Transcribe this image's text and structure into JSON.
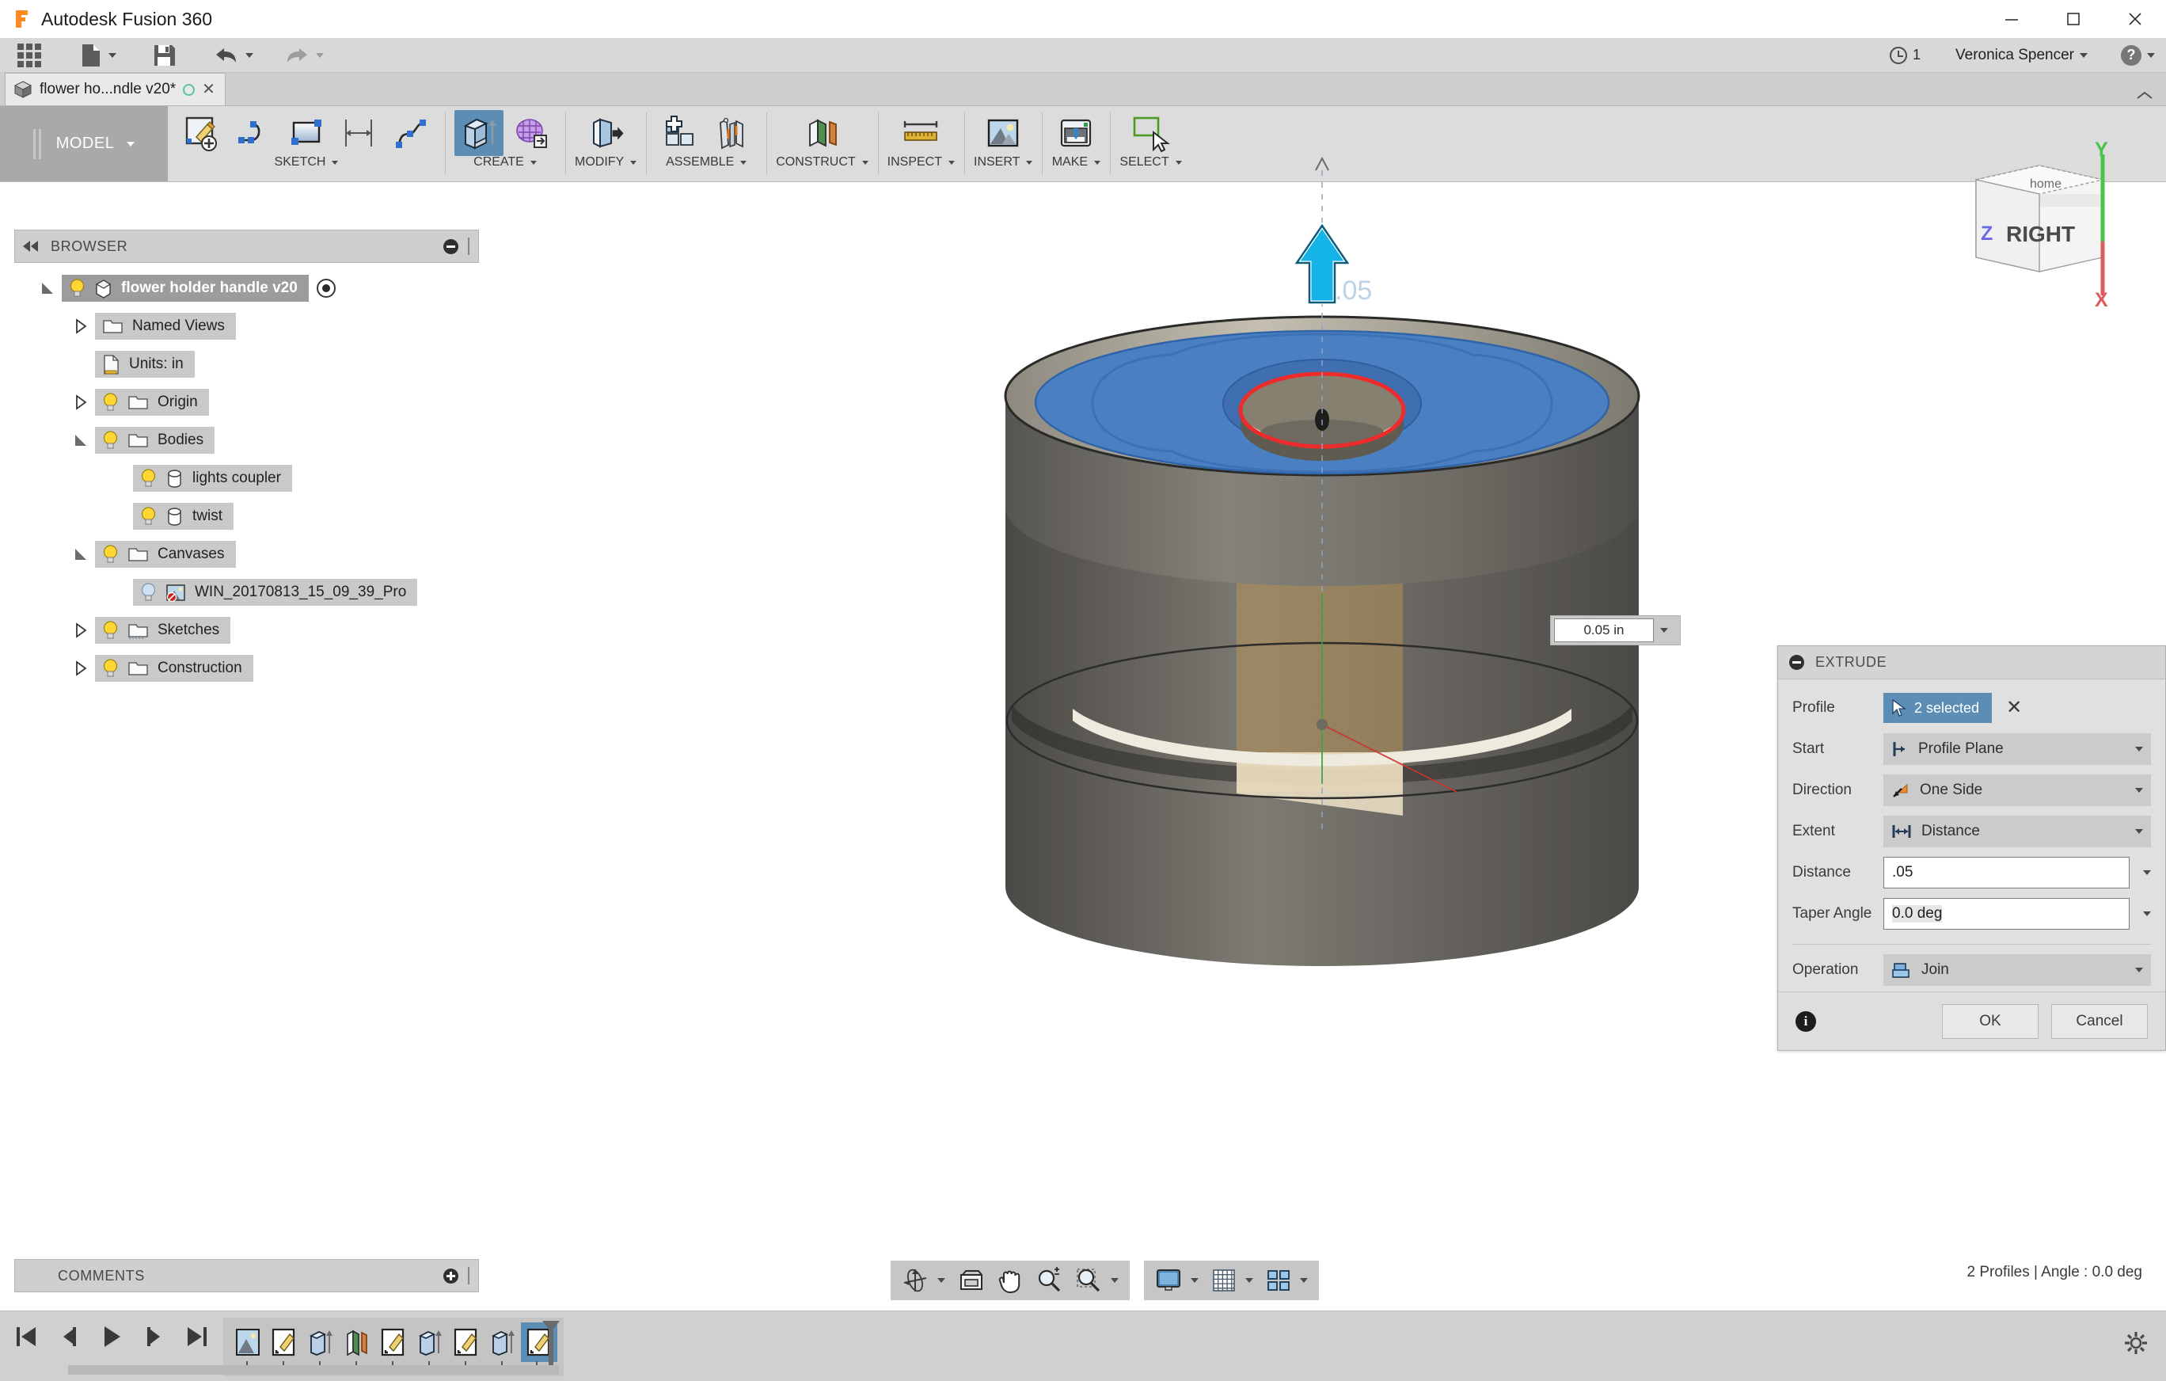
{
  "window": {
    "title": "Autodesk Fusion 360",
    "controls": {
      "minimize": "minimize-icon",
      "maximize": "maximize-icon",
      "close": "close-icon"
    }
  },
  "quick_access": {
    "app_grid": "grid-icon",
    "new_file": "new-file-icon",
    "save": "save-icon",
    "undo": "undo-icon",
    "redo": "redo-icon",
    "job_count": "1",
    "user_name": "Veronica Spencer",
    "help": "?"
  },
  "document_tab": {
    "label": "flower ho...ndle v20*",
    "sync_state": "unsaved-circle",
    "close": "✕"
  },
  "ribbon": {
    "workspace": "MODEL",
    "groups": [
      {
        "label": "SKETCH",
        "icons": [
          "create-sketch-icon",
          "spline-icon",
          "rectangle-icon",
          "dimension-icon",
          "fit-curve-icon"
        ]
      },
      {
        "label": "CREATE",
        "icons": [
          "extrude-icon",
          "create-form-icon"
        ],
        "active_icon": "extrude-icon"
      },
      {
        "label": "MODIFY",
        "icons": [
          "press-pull-icon"
        ]
      },
      {
        "label": "ASSEMBLE",
        "icons": [
          "new-component-icon",
          "joint-icon"
        ]
      },
      {
        "label": "CONSTRUCT",
        "icons": [
          "offset-plane-icon"
        ]
      },
      {
        "label": "INSPECT",
        "icons": [
          "measure-icon"
        ]
      },
      {
        "label": "INSERT",
        "icons": [
          "insert-canvas-icon"
        ]
      },
      {
        "label": "MAKE",
        "icons": [
          "3d-print-icon"
        ]
      },
      {
        "label": "SELECT",
        "icons": [
          "select-window-icon"
        ]
      }
    ]
  },
  "browser": {
    "title": "BROWSER",
    "collapse": "collapse-icon",
    "tree": [
      {
        "label": "flower holder handle v20",
        "indent": 0,
        "twisty": "open",
        "bulb": true,
        "icon": "component-icon",
        "selected": true,
        "radio": true
      },
      {
        "label": "Named Views",
        "indent": 1,
        "twisty": "closed",
        "bulb": false,
        "icon": "folder-icon",
        "selected": false
      },
      {
        "label": "Units: in",
        "indent": 1,
        "twisty": "none",
        "bulb": false,
        "icon": "document-icon",
        "selected": false
      },
      {
        "label": "Origin",
        "indent": 1,
        "twisty": "closed",
        "bulb": true,
        "icon": "folder-icon",
        "selected": false
      },
      {
        "label": "Bodies",
        "indent": 1,
        "twisty": "open",
        "bulb": true,
        "icon": "folder-icon",
        "selected": false
      },
      {
        "label": "lights coupler",
        "indent": 2,
        "twisty": "none",
        "bulb": true,
        "icon": "body-icon",
        "selected": false
      },
      {
        "label": "twist",
        "indent": 2,
        "twisty": "none",
        "bulb": true,
        "icon": "body-icon",
        "selected": false
      },
      {
        "label": "Canvases",
        "indent": 1,
        "twisty": "open",
        "bulb": true,
        "icon": "folder-icon",
        "selected": false
      },
      {
        "label": "WIN_20170813_15_09_39_Pro",
        "indent": 2,
        "twisty": "none",
        "bulb": "off",
        "icon": "canvas-image-icon",
        "selected": false
      },
      {
        "label": "Sketches",
        "indent": 1,
        "twisty": "closed",
        "bulb": true,
        "icon": "sketches-folder-icon",
        "selected": false
      },
      {
        "label": "Construction",
        "indent": 1,
        "twisty": "closed",
        "bulb": true,
        "icon": "folder-icon",
        "selected": false
      }
    ]
  },
  "viewcube": {
    "face": "RIGHT",
    "axis_x": "X",
    "axis_y": "Y",
    "axis_z": "Z"
  },
  "canvas": {
    "manipulator_value": "0.05 in",
    "manipulator_dropdown": "chevron-down-icon",
    "arrow_handle": "extrude-arrow-handle"
  },
  "extrude_dialog": {
    "title": "EXTRUDE",
    "collapse": "collapse-icon",
    "rows": [
      {
        "label": "Profile",
        "type": "select",
        "value": "2 selected",
        "clear": "✕"
      },
      {
        "label": "Start",
        "type": "combo",
        "value": "Profile Plane",
        "icon": "profile-plane-icon"
      },
      {
        "label": "Direction",
        "type": "combo",
        "value": "One Side",
        "icon": "one-side-icon"
      },
      {
        "label": "Extent",
        "type": "combo",
        "value": "Distance",
        "icon": "distance-icon"
      },
      {
        "label": "Distance",
        "type": "field",
        "value": ".05"
      },
      {
        "label": "Taper Angle",
        "type": "field",
        "value": "0.0 deg"
      },
      {
        "label": "Operation",
        "type": "combo",
        "value": "Join",
        "icon": "join-icon"
      }
    ],
    "info": "i",
    "ok_label": "OK",
    "cancel_label": "Cancel"
  },
  "comments": {
    "title": "COMMENTS",
    "add": "add-comment-icon"
  },
  "navbar": {
    "group1": [
      "orbit-icon",
      "fit-icon",
      "pan-icon",
      "zoom-icon",
      "zoom-window-icon"
    ],
    "group2": [
      "display-settings-icon",
      "grid-snap-icon",
      "viewports-icon"
    ]
  },
  "status_bar": {
    "text": "2 Profiles | Angle : 0.0 deg"
  },
  "timeline": {
    "playback": [
      "skip-to-start-icon",
      "step-back-icon",
      "play-icon",
      "step-forward-icon",
      "skip-to-end-icon"
    ],
    "features": [
      {
        "icon": "canvas-feature-icon",
        "active": false
      },
      {
        "icon": "sketch-feature-icon",
        "active": false
      },
      {
        "icon": "extrude-feature-icon",
        "active": false
      },
      {
        "icon": "plane-feature-icon",
        "active": false
      },
      {
        "icon": "sketch-feature-icon",
        "active": false
      },
      {
        "icon": "extrude-feature-icon",
        "active": false
      },
      {
        "icon": "sketch-feature-icon",
        "active": false
      },
      {
        "icon": "extrude-feature-icon",
        "active": false
      },
      {
        "icon": "sketch-feature-icon",
        "active": true
      }
    ],
    "settings": "timeline-settings-icon"
  },
  "colors": {
    "accent_blue": "#5b8db5",
    "selection_blue": "#4a7fc1",
    "highlight_red": "#ee2b2b",
    "arrow_cyan": "#14b4e8",
    "body_gray": "#7d7a73",
    "chrome_gray": "#dcdcdc"
  }
}
